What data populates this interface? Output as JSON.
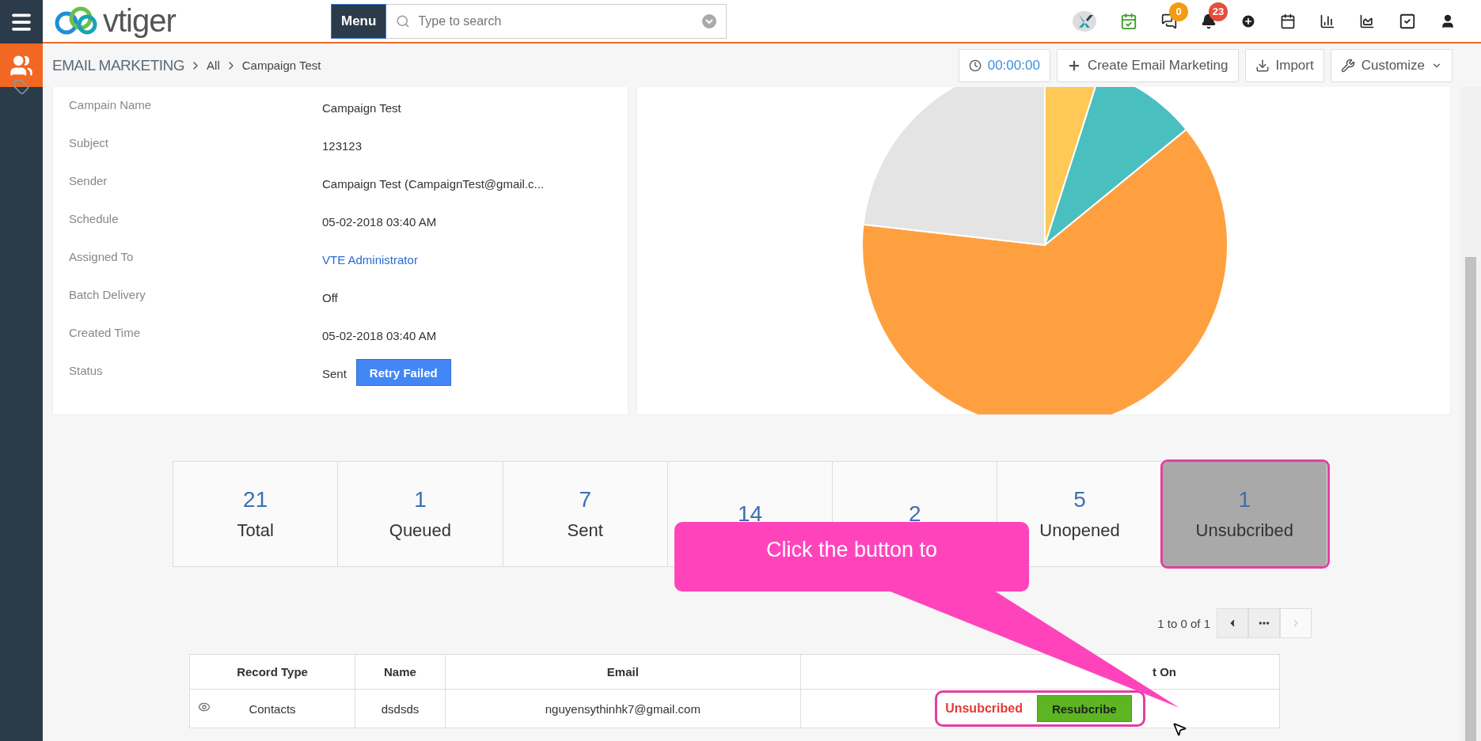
{
  "topbar": {
    "logo": "vtiger",
    "menu_button": "Menu",
    "search": {
      "placeholder": "Type to search"
    },
    "icons": [
      {
        "kind": "app"
      },
      {
        "kind": "calendar-check"
      },
      {
        "kind": "chat",
        "badge": "0",
        "color": "#f39c12"
      },
      {
        "kind": "bell",
        "badge": "23",
        "color": "#e74c3c"
      },
      {
        "kind": "plus"
      },
      {
        "kind": "calendar"
      },
      {
        "kind": "bar-chart"
      },
      {
        "kind": "area-chart"
      },
      {
        "kind": "checkbox"
      },
      {
        "kind": "user"
      }
    ]
  },
  "breadcrumb": {
    "module": "EMAIL MARKETING",
    "items": [
      "All",
      "Campaign Test"
    ]
  },
  "actions": [
    {
      "kind": "timer",
      "label": "00:00:00"
    },
    {
      "kind": "create",
      "label": "Create Email Marketing"
    },
    {
      "kind": "import",
      "label": "Import"
    },
    {
      "kind": "customize",
      "label": "Customize"
    }
  ],
  "details": [
    {
      "kind": "text",
      "label": "Campain Name",
      "value": "Campaign Test"
    },
    {
      "kind": "text",
      "label": "Subject",
      "value": "123123"
    },
    {
      "kind": "text",
      "label": "Sender",
      "value": "Campaign Test (CampaignTest@gmail.c..."
    },
    {
      "kind": "text",
      "label": "Schedule",
      "value": "05-02-2018 03:40 AM"
    },
    {
      "kind": "link",
      "label": "Assigned To",
      "value": "VTE Administrator"
    },
    {
      "kind": "text",
      "label": "Batch Delivery",
      "value": "Off"
    },
    {
      "kind": "text",
      "label": "Created Time",
      "value": "05-02-2018 03:40 AM"
    },
    {
      "kind": "status",
      "label": "Status",
      "value": "Sent",
      "button": "Retry Failed"
    }
  ],
  "stats": [
    {
      "value": "21",
      "label": "Total",
      "selected": false
    },
    {
      "value": "1",
      "label": "Queued",
      "selected": false
    },
    {
      "value": "7",
      "label": "Sent",
      "selected": false
    },
    {
      "value": "14",
      "selected": false
    },
    {
      "value": "2",
      "selected": false
    },
    {
      "value": "5",
      "label": "Unopened",
      "selected": false
    },
    {
      "value": "1",
      "label": "Unsubcribed",
      "selected": true
    }
  ],
  "callout": {
    "text": "Click the button to"
  },
  "pagination": {
    "range": "1 to 0 of 1"
  },
  "table": {
    "columns": [
      "Record Type",
      "Name",
      "Email",
      "t On"
    ],
    "rows": [
      {
        "record_type": "Contacts",
        "name": "dsdsds",
        "email": "nguyensythinhk7@gmail.com",
        "status": "Unsubcribed",
        "action": "Resubcribe"
      }
    ]
  }
}
